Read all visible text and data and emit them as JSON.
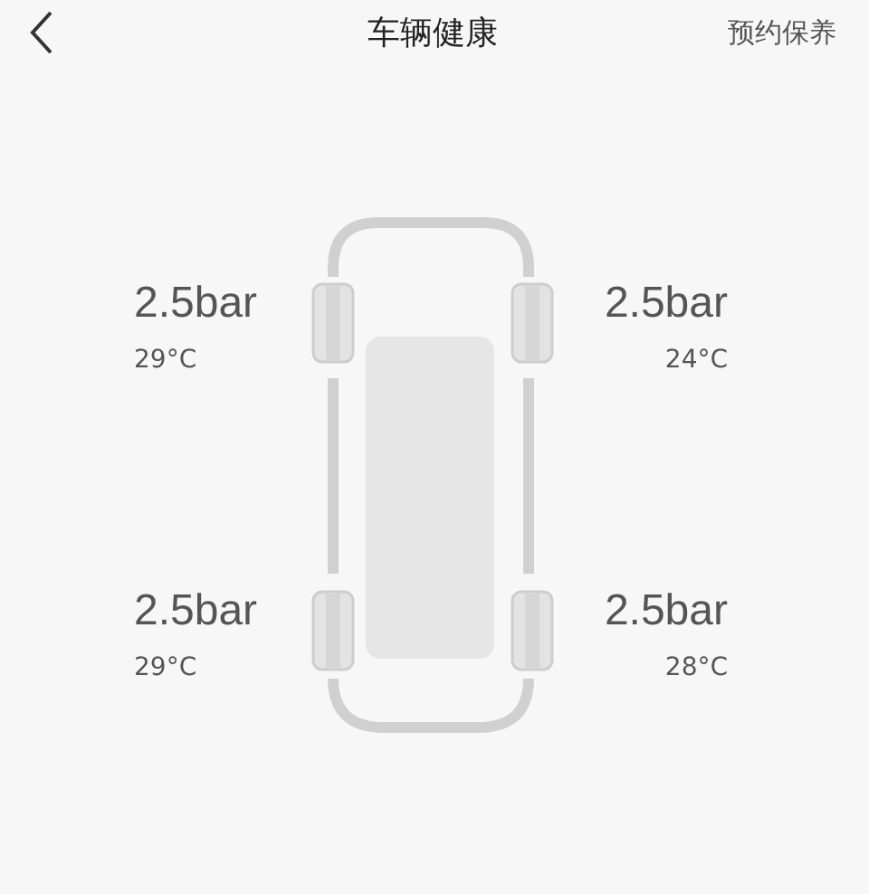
{
  "header": {
    "title": "车辆健康",
    "action": "预约保养"
  },
  "tires": [
    {
      "pressure": "2.5bar",
      "temperature": "29°C"
    },
    {
      "pressure": "2.5bar",
      "temperature": "24°C"
    },
    {
      "pressure": "2.5bar",
      "temperature": "29°C"
    },
    {
      "pressure": "2.5bar",
      "temperature": "28°C"
    }
  ]
}
